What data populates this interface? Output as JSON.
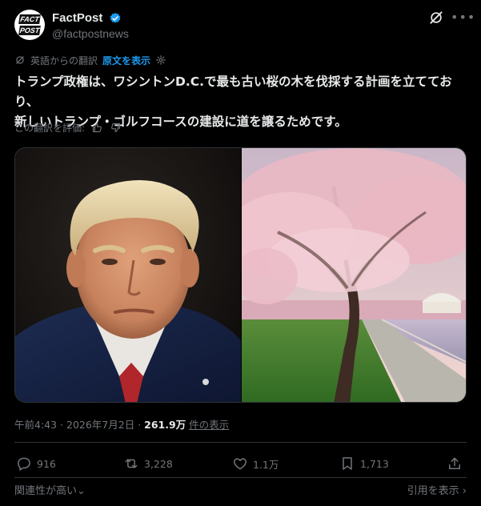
{
  "author": {
    "name": "FactPost",
    "handle": "@factpostnews",
    "logo_text": [
      "FACT",
      "POST"
    ],
    "verified_color": "#1d9bf0"
  },
  "translation": {
    "from_label": "英語からの翻訳",
    "show_original": "原文を表示"
  },
  "post": {
    "text_line1": "トランプ政権は、ワシントンD.C.で最も古い桜の木を伐採する計画を立てており、",
    "text_line2": "新しいトランプ・ゴルフコースの建設に道を譲るためです。"
  },
  "rating": {
    "label": "この翻訳を評価:"
  },
  "meta": {
    "time": "午前4:43",
    "separator": " · ",
    "date": "2026年7月2日",
    "views_count": "261.9万",
    "views_label": "件の表示"
  },
  "actions": {
    "replies": "916",
    "reposts": "3,228",
    "likes": "1.1万",
    "bookmarks": "1,713"
  },
  "footer": {
    "relevance": "関連性が高い",
    "quotes": "引用を表示"
  },
  "icons": {
    "grok": "grok-icon",
    "more": "more-icon",
    "translate": "translate-icon",
    "settings": "gear-icon",
    "thumbs_up": "thumbs-up-icon",
    "thumbs_down": "thumbs-down-icon",
    "reply": "reply-icon",
    "repost": "repost-icon",
    "like": "heart-icon",
    "bookmark": "bookmark-icon",
    "share": "share-icon",
    "chevron": "chevron-down-icon"
  },
  "colors": {
    "background": "#000000",
    "text": "#e7e9ea",
    "muted": "#71767b",
    "accent": "#1d9bf0",
    "border": "#2f3336"
  }
}
